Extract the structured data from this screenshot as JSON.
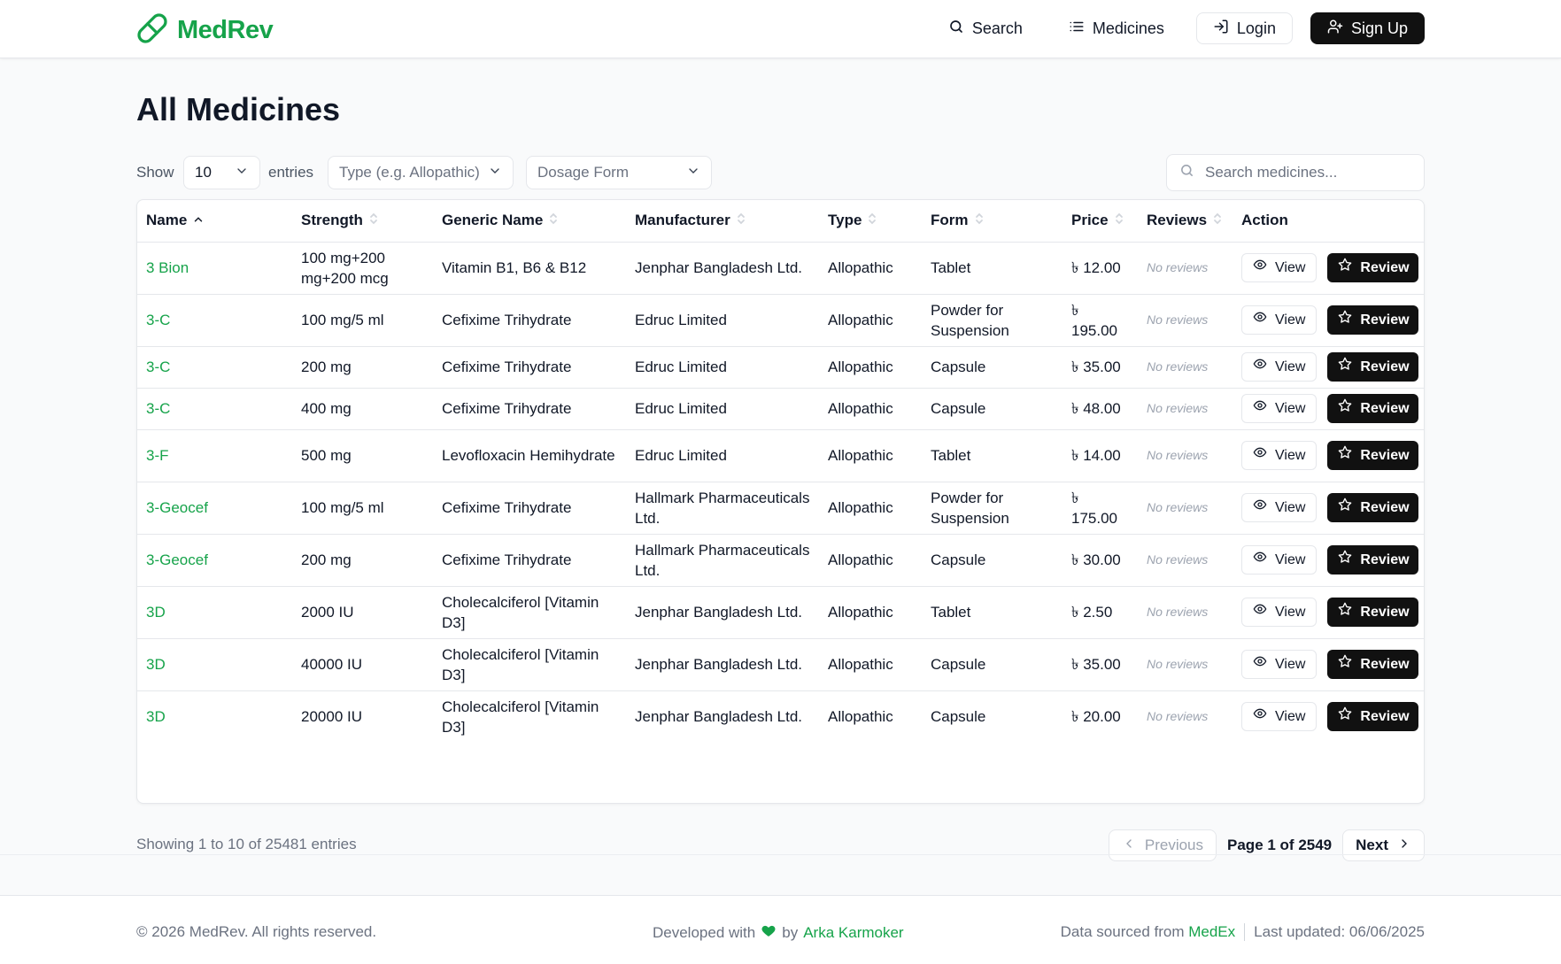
{
  "brand": {
    "name": "MedRev",
    "color": "#16a34a"
  },
  "nav": {
    "search": "Search",
    "medicines": "Medicines",
    "login": "Login",
    "signup": "Sign Up"
  },
  "page": {
    "title": "All Medicines"
  },
  "controls": {
    "show_label": "Show",
    "entries_value": "10",
    "entries_label": "entries",
    "type_placeholder": "Type (e.g. Allopathic)",
    "form_placeholder": "Dosage Form",
    "search_placeholder": "Search medicines..."
  },
  "table": {
    "columns": [
      "Name",
      "Strength",
      "Generic Name",
      "Manufacturer",
      "Type",
      "Form",
      "Price",
      "Reviews",
      "Action"
    ],
    "rows": [
      {
        "name": "3 Bion",
        "strength": "100 mg+200 mg+200 mcg",
        "generic": "Vitamin B1, B6 & B12",
        "manufacturer": "Jenphar Bangladesh Ltd.",
        "type": "Allopathic",
        "form": "Tablet",
        "price": "৳ 12.00",
        "reviews": "No reviews"
      },
      {
        "name": "3-C",
        "strength": "100 mg/5 ml",
        "generic": "Cefixime Trihydrate",
        "manufacturer": "Edruc Limited",
        "type": "Allopathic",
        "form": "Powder for Suspension",
        "price": "৳ 195.00",
        "reviews": "No reviews"
      },
      {
        "name": "3-C",
        "strength": "200 mg",
        "generic": "Cefixime Trihydrate",
        "manufacturer": "Edruc Limited",
        "type": "Allopathic",
        "form": "Capsule",
        "price": "৳ 35.00",
        "reviews": "No reviews"
      },
      {
        "name": "3-C",
        "strength": "400 mg",
        "generic": "Cefixime Trihydrate",
        "manufacturer": "Edruc Limited",
        "type": "Allopathic",
        "form": "Capsule",
        "price": "৳ 48.00",
        "reviews": "No reviews"
      },
      {
        "name": "3-F",
        "strength": "500 mg",
        "generic": "Levofloxacin Hemihydrate",
        "manufacturer": "Edruc Limited",
        "type": "Allopathic",
        "form": "Tablet",
        "price": "৳ 14.00",
        "reviews": "No reviews"
      },
      {
        "name": "3-Geocef",
        "strength": "100 mg/5 ml",
        "generic": "Cefixime Trihydrate",
        "manufacturer": "Hallmark Pharmaceuticals Ltd.",
        "type": "Allopathic",
        "form": "Powder for Suspension",
        "price": "৳ 175.00",
        "reviews": "No reviews"
      },
      {
        "name": "3-Geocef",
        "strength": "200 mg",
        "generic": "Cefixime Trihydrate",
        "manufacturer": "Hallmark Pharmaceuticals Ltd.",
        "type": "Allopathic",
        "form": "Capsule",
        "price": "৳ 30.00",
        "reviews": "No reviews"
      },
      {
        "name": "3D",
        "strength": "2000 IU",
        "generic": "Cholecalciferol [Vitamin D3]",
        "manufacturer": "Jenphar Bangladesh Ltd.",
        "type": "Allopathic",
        "form": "Tablet",
        "price": "৳ 2.50",
        "reviews": "No reviews"
      },
      {
        "name": "3D",
        "strength": "40000 IU",
        "generic": "Cholecalciferol [Vitamin D3]",
        "manufacturer": "Jenphar Bangladesh Ltd.",
        "type": "Allopathic",
        "form": "Capsule",
        "price": "৳ 35.00",
        "reviews": "No reviews"
      },
      {
        "name": "3D",
        "strength": "20000 IU",
        "generic": "Cholecalciferol [Vitamin D3]",
        "manufacturer": "Jenphar Bangladesh Ltd.",
        "type": "Allopathic",
        "form": "Capsule",
        "price": "৳ 20.00",
        "reviews": "No reviews"
      }
    ],
    "view_label": "View",
    "review_label": "Review"
  },
  "pagination": {
    "showing": "Showing 1 to 10 of 25481 entries",
    "previous": "Previous",
    "page_info": "Page 1 of 2549",
    "next": "Next"
  },
  "footer": {
    "copyright": "© 2026 MedRev. All rights reserved.",
    "developed_prefix": "Developed with",
    "developed_by": "by",
    "developer": "Arka Karmoker",
    "source_prefix": "Data sourced from",
    "source_name": "MedEx",
    "last_updated": "Last updated: 06/06/2025"
  }
}
